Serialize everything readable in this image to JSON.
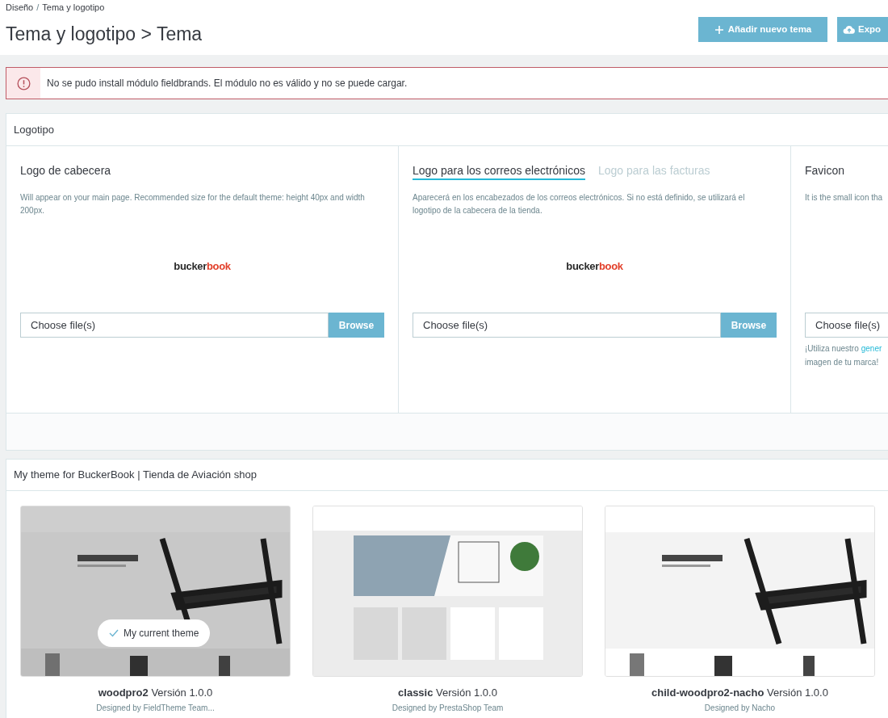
{
  "breadcrumb": [
    "Diseño",
    "Tema y logotipo"
  ],
  "breadcrumb_separator": "/",
  "title": "Tema y logotipo > Tema",
  "header_buttons": [
    {
      "kind": "add",
      "label": "Añadir nuevo tema"
    },
    {
      "kind": "export",
      "label": "Expo"
    }
  ],
  "alert": {
    "text": "No se pudo install módulo fieldbrands. El módulo no es válido y no se puede cargar."
  },
  "logo_panel": {
    "title": "Logotipo",
    "columns": [
      {
        "heading": "Logo de cabecera",
        "description": "Will appear on your main page. Recommended size for the default theme: height 40px and width 200px.",
        "logo": [
          "bucker",
          "book"
        ],
        "file_placeholder": "Choose file(s)",
        "browse": "Browse"
      },
      {
        "tabs": [
          {
            "label": "Logo para los correos electrónicos",
            "selected": true
          },
          {
            "label": "Logo para las facturas",
            "selected": false
          }
        ],
        "description": "Aparecerá en los encabezados de los correos electrónicos. Si no está definido, se utilizará el logotipo de la cabecera de la tienda.",
        "logo": [
          "bucker",
          "book"
        ],
        "file_placeholder": "Choose file(s)",
        "browse": "Browse"
      },
      {
        "heading": "Favicon",
        "description": "It is the small icon tha",
        "file_placeholder": "Choose file(s)",
        "hint": {
          "text": "¡Utiliza nuestro",
          "link": "gener",
          "continuation": "imagen de tu marca!"
        }
      }
    ]
  },
  "themes_panel": {
    "title": "My theme for BuckerBook | Tienda de Aviación shop",
    "themes": [
      {
        "name": "woodpro2",
        "version": "Versión 1.0.0",
        "designer": "Designed by FieldTheme Team...",
        "current": true,
        "current_label": "My current theme"
      },
      {
        "name": "classic",
        "version": "Versión 1.0.0",
        "designer": "Designed by PrestaShop Team",
        "current": false
      },
      {
        "name": "child-woodpro2-nacho",
        "version": "Versión 1.0.0",
        "designer": "Designed by Nacho",
        "current": false
      }
    ]
  }
}
